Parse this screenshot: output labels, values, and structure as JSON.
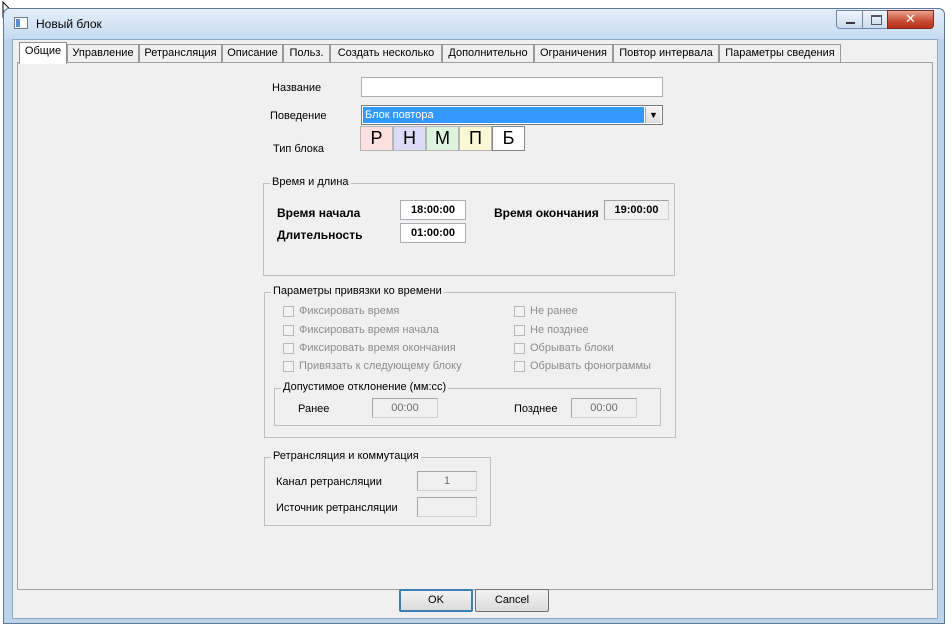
{
  "window": {
    "title": "Новый блок"
  },
  "tabs": [
    {
      "label": "Общие"
    },
    {
      "label": "Управление"
    },
    {
      "label": "Ретрансляция"
    },
    {
      "label": "Описание"
    },
    {
      "label": "Польз."
    },
    {
      "label": "Создать несколько"
    },
    {
      "label": "Дополнительно"
    },
    {
      "label": "Ограничения"
    },
    {
      "label": "Повтор интервала"
    },
    {
      "label": "Параметры сведения"
    }
  ],
  "general": {
    "name_label": "Название",
    "name_value": "",
    "behavior_label": "Поведение",
    "behavior_value": "Блок повтора",
    "block_type_label": "Тип блока",
    "block_types": [
      {
        "letter": "Р",
        "color": "#fde0e0"
      },
      {
        "letter": "Н",
        "color": "#dcdcf8"
      },
      {
        "letter": "М",
        "color": "#ddf3dd"
      },
      {
        "letter": "П",
        "color": "#fbf8d5"
      },
      {
        "letter": "Б",
        "color": "#ffffff"
      }
    ]
  },
  "time_group": {
    "caption": "Время и длина",
    "start_label": "Время начала",
    "start_value": "18:00:00",
    "end_label": "Время окончания",
    "end_value": "19:00:00",
    "duration_label": "Длительность",
    "duration_value": "01:00:00"
  },
  "binding_group": {
    "caption": "Параметры привязки ко времени",
    "left": [
      "Фиксировать время",
      "Фиксировать время начала",
      "Фиксировать время окончания",
      "Привязать к следующему блоку"
    ],
    "right": [
      "Не ранее",
      "Не позднее",
      "Обрывать блоки",
      "Обрывать фонограммы"
    ],
    "deviation": {
      "caption": "Допустимое отклонение (мм:сс)",
      "early_label": "Ранее",
      "early_value": "00:00",
      "late_label": "Позднее",
      "late_value": "00:00"
    }
  },
  "relay_group": {
    "caption": "Ретрансляция и коммутация",
    "channel_label": "Канал ретрансляции",
    "channel_value": "1",
    "source_label": "Источник ретрансляции",
    "source_value": ""
  },
  "buttons": {
    "ok": "OK",
    "cancel": "Cancel"
  }
}
